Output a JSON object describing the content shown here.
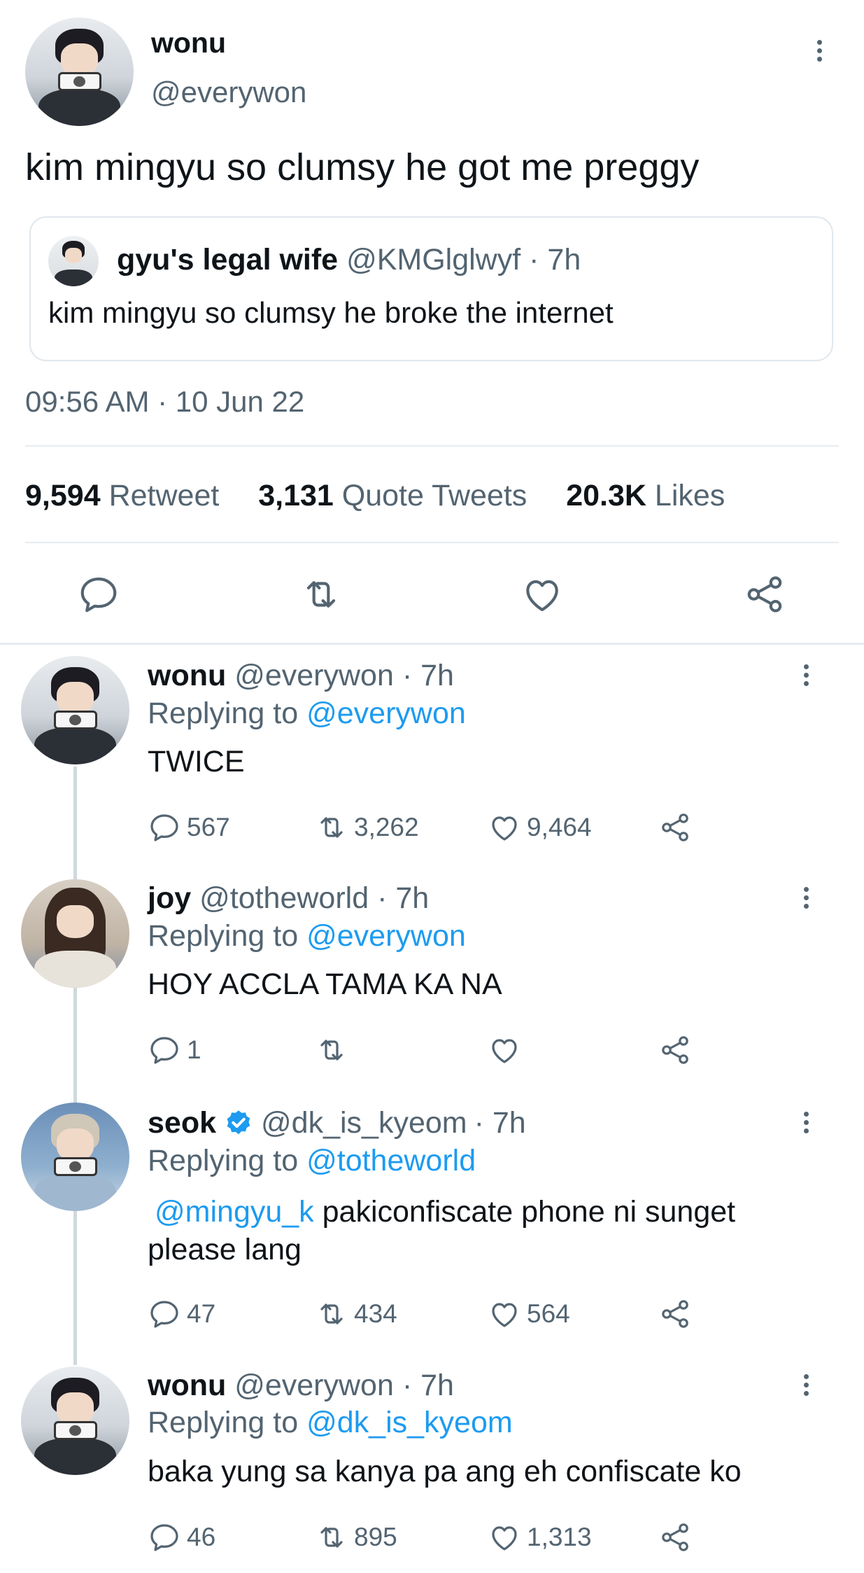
{
  "tweet": {
    "author_name": "wonu",
    "author_handle": "@everywon",
    "text": "kim mingyu so clumsy he got me preggy",
    "quoted": {
      "author_name": "gyu's legal wife",
      "author_handle": "@KMGlglwyf",
      "time": "· 7h",
      "text": "kim mingyu so clumsy he broke the internet"
    },
    "timestamp": "09:56 AM · 10 Jun 22",
    "stats": {
      "retweets_count": "9,594",
      "retweets_label": "Retweet",
      "quotes_count": "3,131",
      "quotes_label": "Quote Tweets",
      "likes_count": "20.3K",
      "likes_label": "Likes"
    },
    "action_icons": [
      "reply-icon",
      "retweet-icon",
      "like-icon",
      "share-icon"
    ]
  },
  "replies": [
    {
      "name": "wonu",
      "handle": "@everywon",
      "time": "· 7h",
      "replying_prefix": "Replying to",
      "replying_to": "@everywon",
      "text": "TWICE",
      "counts": {
        "reply": "567",
        "retweet": "3,262",
        "like": "9,464"
      }
    },
    {
      "name": "joy",
      "handle": "@totheworld",
      "time": "· 7h",
      "replying_prefix": "Replying to",
      "replying_to": "@everywon",
      "text": "HOY ACCLA TAMA KA NA",
      "counts": {
        "reply": "1",
        "retweet": "",
        "like": ""
      }
    },
    {
      "name": "seok",
      "handle": "@dk_is_kyeom",
      "time": "· 7h",
      "verified": true,
      "replying_prefix": "Replying to",
      "replying_to": "@totheworld",
      "mention": "@mingyu_k",
      "text_line1": " pakiconfiscate phone ni sunget",
      "text_line2": "please lang",
      "counts": {
        "reply": "47",
        "retweet": "434",
        "like": "564"
      }
    },
    {
      "name": "wonu",
      "handle": "@everywon",
      "time": "· 7h",
      "replying_prefix": "Replying to",
      "replying_to": "@dk_is_kyeom",
      "text": "baka yung sa kanya pa ang eh confiscate ko",
      "counts": {
        "reply": "46",
        "retweet": "895",
        "like": "1,313"
      }
    }
  ],
  "colors": {
    "link": "#1d9bf0",
    "muted": "#536471",
    "divider": "#e6ecf0",
    "text": "#0f1419"
  }
}
